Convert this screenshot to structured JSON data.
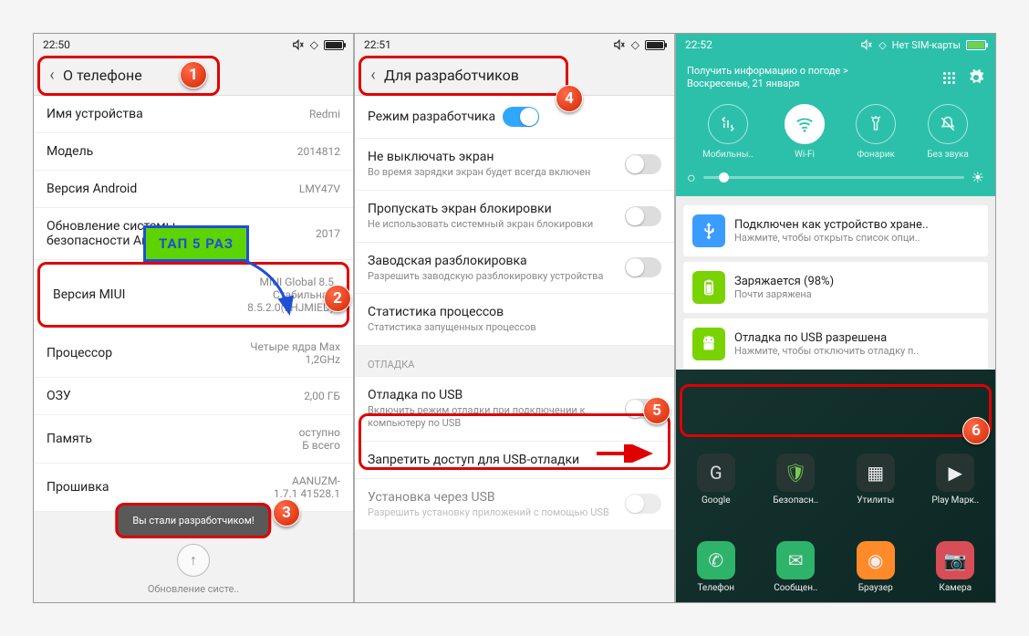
{
  "phone1": {
    "time": "22:50",
    "title": "О телефоне",
    "rows": {
      "device_name": {
        "label": "Имя устройства",
        "value": "Redmi"
      },
      "model": {
        "label": "Модель",
        "value": "2014812"
      },
      "android_ver": {
        "label": "Версия Android",
        "value": "LMY47V"
      },
      "security": {
        "label": "Обновление системы безопасности Android",
        "value": "2017"
      },
      "miui": {
        "label": "Версия MIUI",
        "value": "MIUI Global 8.5\nСтабильная\n8.5.2.0(LHJMIED)"
      },
      "cpu": {
        "label": "Процессор",
        "value": "Четыре ядра Max\n1,2GHz"
      },
      "ram": {
        "label": "ОЗУ",
        "value": "2,00 ГБ"
      },
      "storage": {
        "label": "Память",
        "value": "оступно\nБ всего"
      },
      "firmware": {
        "label": "Прошивка",
        "value": "AANUZM-\n1.7.1 41528.1"
      }
    },
    "toast": "Вы стали разработчиком!",
    "update_text": "Обновление систе..",
    "callout": "ТАП 5 РАЗ"
  },
  "phone2": {
    "time": "22:51",
    "title": "Для разработчиков",
    "rows": {
      "dev_mode": {
        "label": "Режим разработчика"
      },
      "no_sleep": {
        "label": "Не выключать экран",
        "sub": "Во время зарядки экран будет всегда включен"
      },
      "skip_lock": {
        "label": "Пропускать экран блокировки",
        "sub": "Не использовать системный экран блокировки"
      },
      "oem": {
        "label": "Заводская разблокировка",
        "sub": "Разрешить заводскую разблокировку устройства"
      },
      "proc": {
        "label": "Статистика процессов",
        "sub": "Статистика запущенных процессов"
      },
      "section": "ОТЛАДКА",
      "usb_debug": {
        "label": "Отладка по USB",
        "sub": "Включить режим отладки при подключении к компьютеру по USB"
      },
      "revoke": {
        "label": "Запретить доступ для USB-отладки"
      },
      "install_usb": {
        "label": "Установка через USB",
        "sub": "Разрешить установку приложений с помощью USB"
      }
    }
  },
  "phone3": {
    "time": "22:52",
    "sim": "Нет SIM-карты",
    "weather": "Получить информацию о погоде >",
    "date": "Воскресенье, 21 января",
    "qs": {
      "mobile": "Мобильны..",
      "wifi": "Wi-Fi",
      "torch": "Фонарик",
      "silent": "Без звука"
    },
    "notifs": {
      "usb_storage": {
        "title": "Подключен как устройство хране..",
        "sub": "Нажмите, чтобы открыть список опци.."
      },
      "charging": {
        "title": "Заряжается (98%)",
        "sub": "Почти заряжена"
      },
      "debug": {
        "title": "Отладка по USB разрешена",
        "sub": "Нажмите, чтобы отключить отладку п.."
      }
    },
    "apps_top": {
      "google": "Google",
      "security": "Безопасн..",
      "utils": "Утилиты",
      "play": "Play Марк.."
    },
    "apps_bottom": {
      "phone": "Телефон",
      "sms": "Сообщен..",
      "browser": "Браузер",
      "camera": "Камера"
    }
  }
}
